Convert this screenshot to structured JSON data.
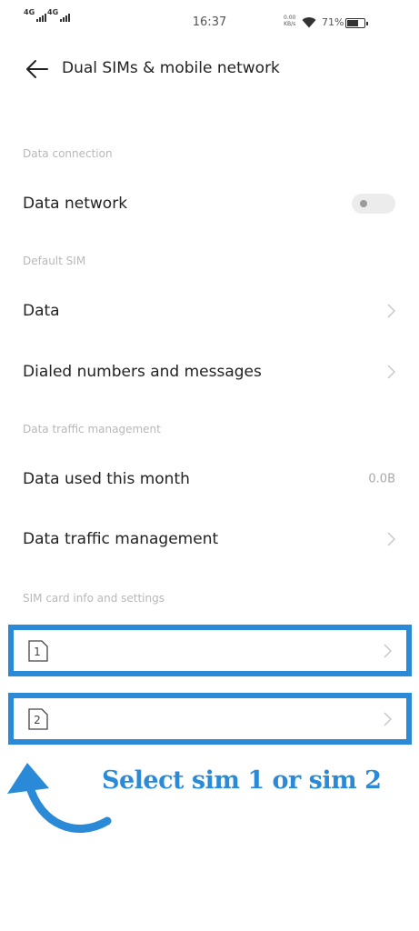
{
  "status_bar": {
    "sim1_network": "4G",
    "sim2_network": "4G",
    "time": "16:37",
    "net_speed_value": "0.00",
    "net_speed_unit": "KB/s",
    "battery_percent": "71%",
    "battery_level": 0.71,
    "icons": [
      "signal-icon",
      "wifi-icon",
      "battery-icon"
    ]
  },
  "header": {
    "title": "Dual SIMs & mobile network",
    "back_icon": "back-arrow-icon"
  },
  "sections": {
    "data_connection": "Data connection",
    "default_sim": "Default SIM",
    "data_traffic": "Data traffic management",
    "sim_info": "SIM card info and settings"
  },
  "rows": {
    "data_network": {
      "label": "Data network",
      "toggle_on": false
    },
    "data": {
      "label": "Data"
    },
    "dialed": {
      "label": "Dialed numbers and messages"
    },
    "data_used": {
      "label": "Data used this month",
      "value": "0.0B"
    },
    "traffic_mgmt": {
      "label": "Data traffic management"
    }
  },
  "sims": [
    {
      "number": "1"
    },
    {
      "number": "2"
    }
  ],
  "annotation": {
    "caption": "Select sim 1 or sim 2",
    "color": "#2a8ad8"
  },
  "colors": {
    "highlight": "#2a8ad8",
    "section_label": "#b8b8b8"
  }
}
